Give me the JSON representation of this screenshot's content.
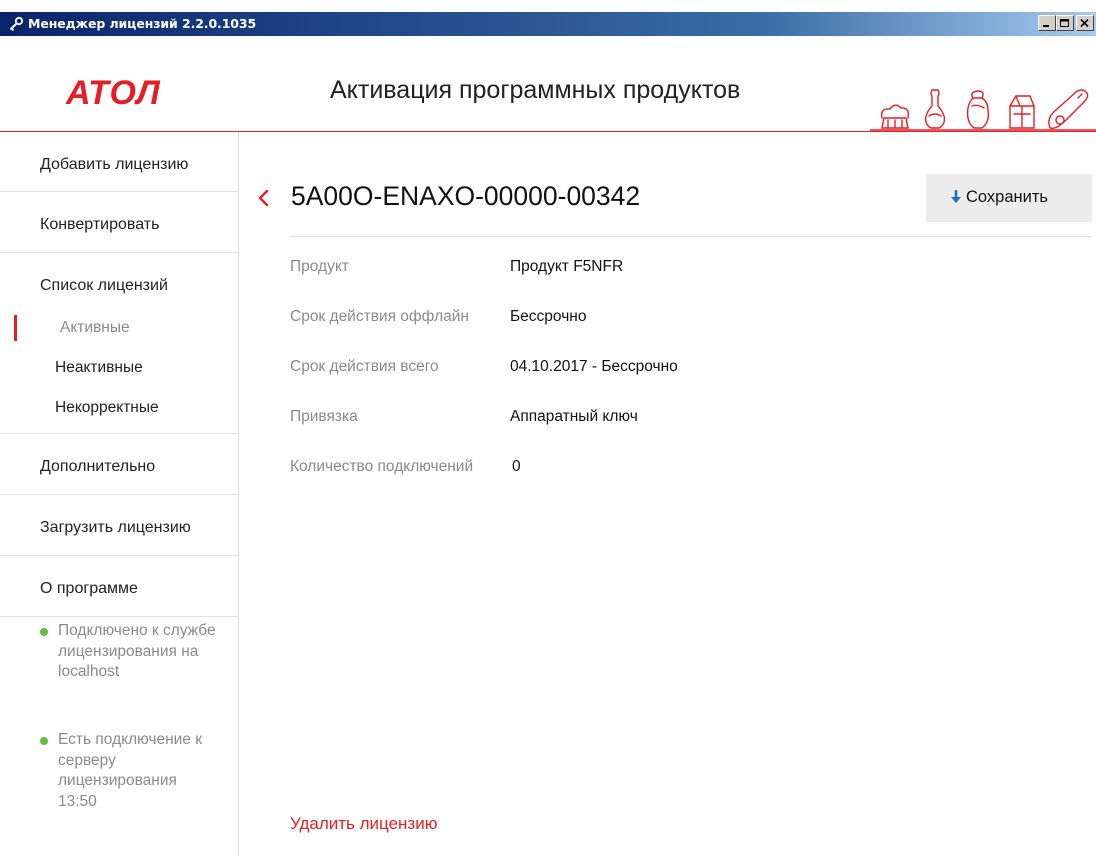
{
  "window": {
    "title": "Менеджер лицензий 2.2.0.1035"
  },
  "header": {
    "logo": "АТОЛ",
    "title": "Активация программных продуктов"
  },
  "sidebar": {
    "items": [
      {
        "label": "Добавить лицензию"
      },
      {
        "label": "Конвертировать"
      },
      {
        "label": "Список лицензий"
      }
    ],
    "sub_items": [
      {
        "label": "Активные",
        "active": true
      },
      {
        "label": "Неактивные",
        "active": false
      },
      {
        "label": "Некорректные",
        "active": false
      }
    ],
    "bottom_items": [
      {
        "label": "Дополнительно"
      },
      {
        "label": "Загрузить лицензию"
      },
      {
        "label": "О программе"
      }
    ],
    "status": [
      {
        "text": "Подключено к службе лицензирования на localhost",
        "color": "#66bb44"
      },
      {
        "text": "Есть подключение к серверу лицензирования 13:50",
        "color": "#66bb44"
      }
    ]
  },
  "main": {
    "license_key": "5A00O-ENAXO-00000-00342",
    "save_label": "Сохранить",
    "fields": [
      {
        "label": "Продукт",
        "value": "Продукт F5NFR"
      },
      {
        "label": "Срок действия оффлайн",
        "value": "Бессрочно"
      },
      {
        "label": "Срок действия всего",
        "value": "04.10.2017 - Бессрочно"
      },
      {
        "label": "Привязка",
        "value": "Аппаратный ключ"
      },
      {
        "label": "Количество подключений",
        "value": "0"
      }
    ],
    "delete_label": "Удалить лицензию"
  },
  "colors": {
    "accent": "#e31e24",
    "status_ok": "#66bb44",
    "save_icon": "#1f6fc4"
  },
  "icons": {
    "app": "key-icon",
    "back": "chevron-left-icon",
    "save": "arrow-down-icon",
    "status": "status-dot-icon"
  }
}
